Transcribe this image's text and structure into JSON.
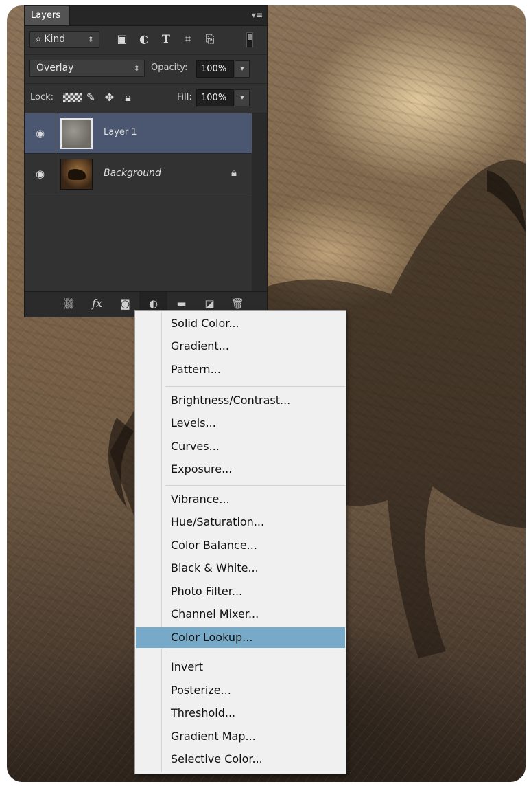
{
  "panel": {
    "tab_label": "Layers",
    "menu_glyph": "▾≡",
    "filter": {
      "label": "Kind",
      "icons": [
        "pixel-layer-filter-icon",
        "adjustment-layer-filter-icon",
        "type-layer-filter-icon",
        "shape-layer-filter-icon",
        "smart-object-filter-icon"
      ]
    },
    "blend_mode": "Overlay",
    "opacity_label": "Opacity:",
    "opacity_value": "100%",
    "lock_label": "Lock:",
    "fill_label": "Fill:",
    "fill_value": "100%",
    "layers": [
      {
        "name": "Layer 1",
        "selected": true,
        "visible": true,
        "locked": false
      },
      {
        "name": "Background",
        "selected": false,
        "visible": true,
        "locked": true
      }
    ],
    "footer_icons": [
      "link-layers-icon",
      "fx-icon",
      "layer-mask-icon",
      "adjustment-layer-icon",
      "group-folder-icon",
      "new-layer-icon",
      "trash-icon"
    ],
    "fx_text": "fx"
  },
  "menu": {
    "groups": [
      [
        "Solid Color...",
        "Gradient...",
        "Pattern..."
      ],
      [
        "Brightness/Contrast...",
        "Levels...",
        "Curves...",
        "Exposure..."
      ],
      [
        "Vibrance...",
        "Hue/Saturation...",
        "Color Balance...",
        "Black & White...",
        "Photo Filter...",
        "Channel Mixer...",
        "Color Lookup..."
      ],
      [
        "Invert",
        "Posterize...",
        "Threshold...",
        "Gradient Map...",
        "Selective Color..."
      ]
    ],
    "highlighted": "Color Lookup...",
    "highlight_color": "#77aac8"
  }
}
